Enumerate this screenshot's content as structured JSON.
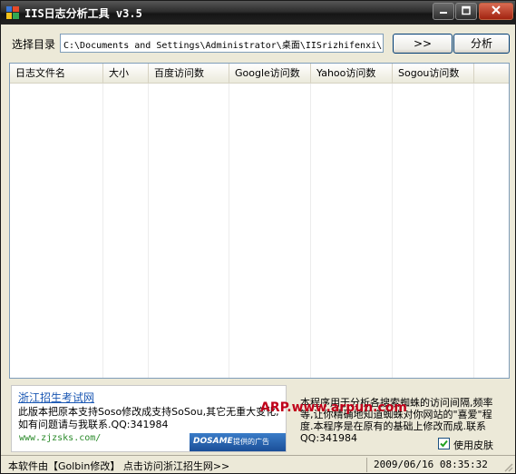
{
  "titlebar": {
    "title": "IIS日志分析工具 v3.5"
  },
  "toolbar": {
    "dir_label": "选择目录",
    "dir_value": "C:\\Documents and Settings\\Administrator\\桌面\\IISrizhifenxi\\",
    "browse_label": ">>",
    "analyze_label": "分析"
  },
  "list": {
    "columns": [
      "日志文件名",
      "大小",
      "百度访问数",
      "Google访问数",
      "Yahoo访问数",
      "Sogou访问数"
    ]
  },
  "promo": {
    "link_text": "浙江招生考试网",
    "text": "此版本把原本支持Soso修改成支持SoSou,其它无重大变化,如有问题请与我联系.QQ:341984",
    "url": "www.zjzsks.com/",
    "banner_brand": "DOSAME",
    "banner_text": "提供的广告"
  },
  "watermark": "ARP.www.arpun.com",
  "description": "本程序用于分析各搜索蜘蛛的访问间隔,频率等,让你精确地知道蜘蛛对你网站的\"喜爱\"程度.本程序是在原有的基础上修改而成.联系QQ:341984",
  "skin": {
    "label": "使用皮肤",
    "checked": true
  },
  "status": {
    "text": "本软件由【Golbin修改】 点击访问浙江招生网>>",
    "time": "2009/06/16 08:35:32"
  },
  "colors": {
    "titlebar": "#232323",
    "link": "#1a57b3",
    "watermark": "#c0001a"
  }
}
